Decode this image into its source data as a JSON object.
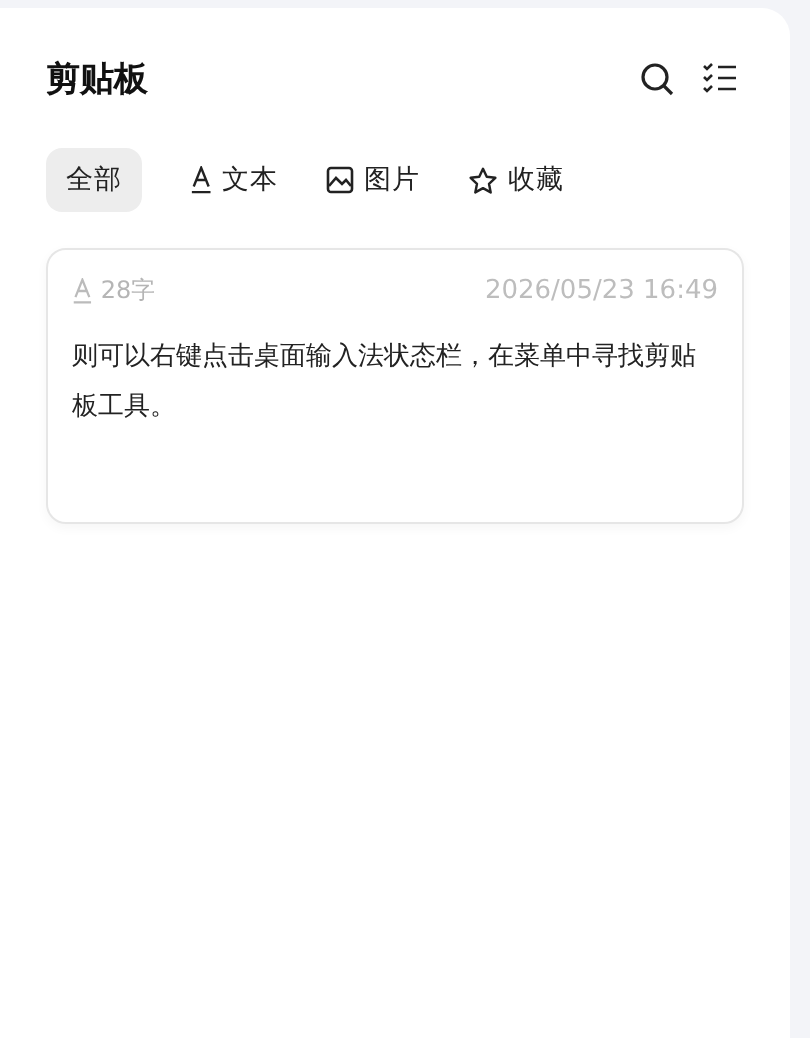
{
  "title": "剪贴板",
  "tabs": [
    {
      "label": "全部",
      "kind": "all",
      "selected": true
    },
    {
      "label": "文本",
      "kind": "text",
      "selected": false
    },
    {
      "label": "图片",
      "kind": "image",
      "selected": false
    },
    {
      "label": "收藏",
      "kind": "favorite",
      "selected": false
    }
  ],
  "items": [
    {
      "kind": "text",
      "count": "28字",
      "time": "2026/05/23 16:49",
      "content": "则可以右键点击桌面输入法状态栏，在菜单中寻找剪贴板工具。"
    }
  ]
}
